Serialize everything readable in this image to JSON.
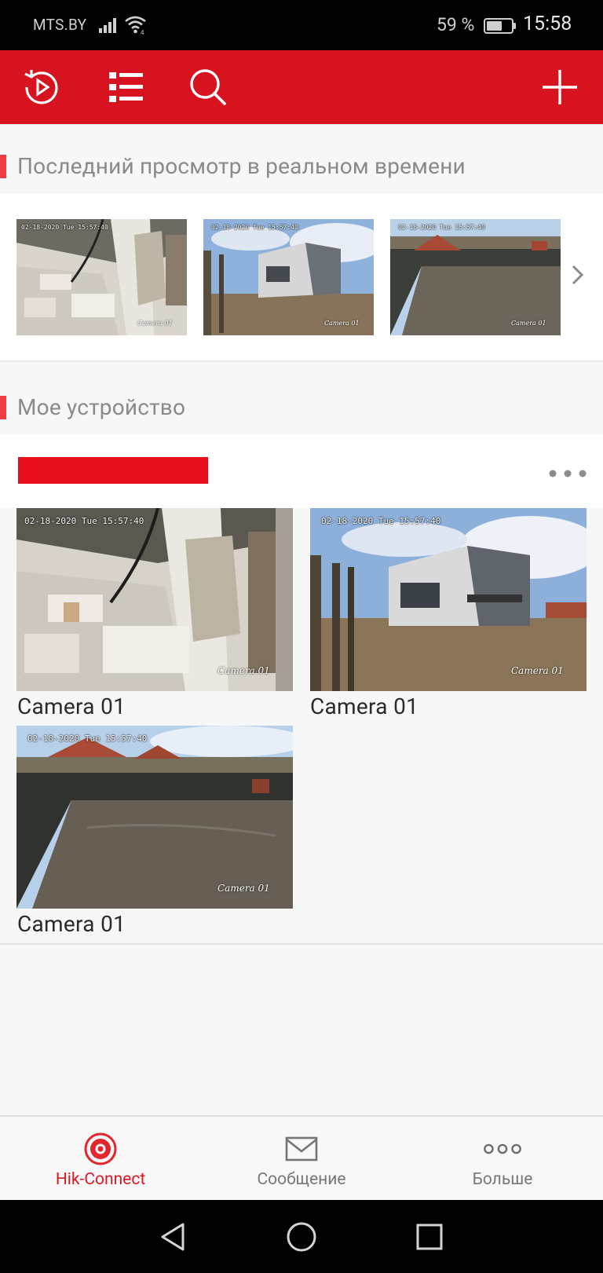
{
  "status_bar": {
    "carrier": "MTS.BY",
    "battery_percent": "59 %",
    "time": "15:58"
  },
  "toolbar": {
    "icons": [
      "playback-icon",
      "list-icon",
      "search-icon",
      "add-icon"
    ]
  },
  "sections": {
    "recent": {
      "title": "Последний просмотр в реальном времени"
    },
    "devices": {
      "title": "Мое устройство"
    }
  },
  "recent_thumbnails": [
    {
      "timestamp": "02-18-2020 Tue 15:57:40",
      "camera": "Camera 01"
    },
    {
      "timestamp": "02-18-2020 Tue 15:57:40",
      "camera": "Camera 01"
    },
    {
      "timestamp": "02-18-2020 Tue 15:57:40",
      "camera": "Camera 01"
    }
  ],
  "device": {
    "name_redacted": true,
    "cameras": [
      {
        "label": "Camera 01",
        "timestamp": "02-18-2020 Tue 15:57:40",
        "overlay": "Camera 01"
      },
      {
        "label": "Camera 01",
        "timestamp": "02-18-2020 Tue 15:57:40",
        "overlay": "Camera 01"
      },
      {
        "label": "Camera 01",
        "timestamp": "02-18-2020 Tue 15:57:40",
        "overlay": "Camera 01"
      }
    ]
  },
  "tabbar": {
    "tabs": [
      {
        "label": "Hik-Connect",
        "icon": "hik-connect-icon",
        "active": true
      },
      {
        "label": "Сообщение",
        "icon": "envelope-icon",
        "active": false
      },
      {
        "label": "Больше",
        "icon": "more-dots-icon",
        "active": false
      }
    ]
  },
  "colors": {
    "brand_red": "#d7131f",
    "section_marker": "#ef3b43",
    "active_tab": "#d81a24"
  }
}
